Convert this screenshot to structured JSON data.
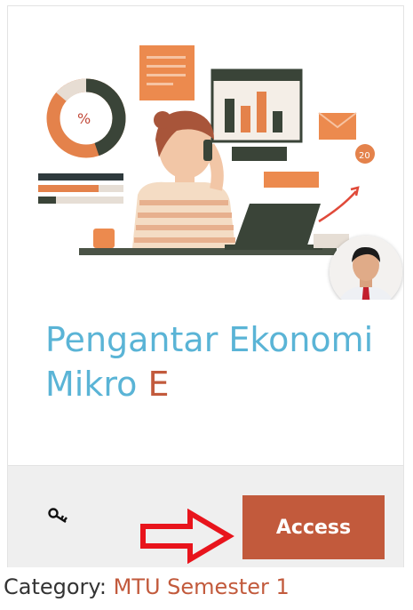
{
  "theme": {
    "accent": "#c25a3c",
    "title_blue": "#5ab4d6",
    "arrow_red": "#e8141c"
  },
  "course": {
    "title_main": "Pengantar Ekonomi Mikro",
    "title_suffix": "E",
    "illustration": "person-on-phone-with-charts-illustration",
    "avatar": "teacher-avatar"
  },
  "footer": {
    "key_icon": "key-icon",
    "arrow_icon": "right-arrow-icon",
    "access_label": "Access"
  },
  "category": {
    "label": "Category:",
    "value": "MTU Semester 1"
  }
}
